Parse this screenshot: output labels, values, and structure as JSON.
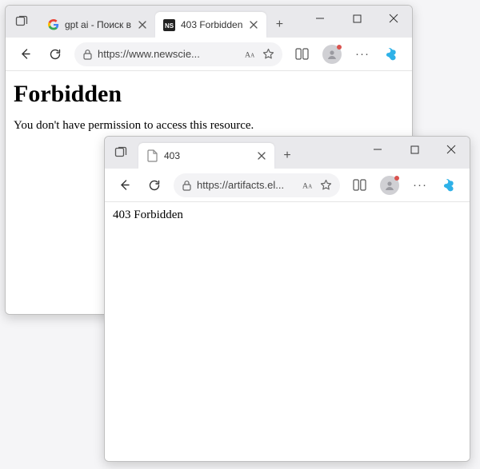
{
  "window_a": {
    "tabs": [
      {
        "title": "gpt ai - Поиск в",
        "favicon": "google"
      },
      {
        "title": "403 Forbidden",
        "favicon": "ns"
      }
    ],
    "address_url": "https://www.newscie...",
    "page": {
      "heading": "Forbidden",
      "message": "You don't have permission to access this resource."
    }
  },
  "window_b": {
    "tabs": [
      {
        "title": "403",
        "favicon": "blank"
      }
    ],
    "address_url": "https://artifacts.el...",
    "page": {
      "text": "403 Forbidden"
    }
  },
  "labels": {
    "new_tab": "+",
    "more": "···"
  }
}
